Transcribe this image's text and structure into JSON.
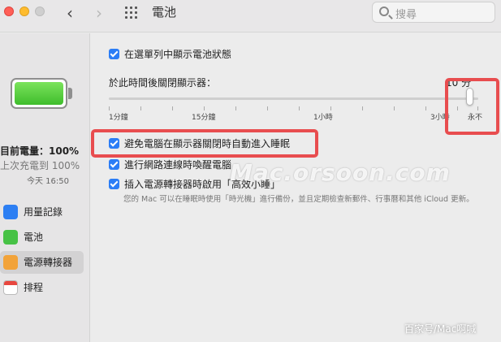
{
  "window": {
    "title": "電池"
  },
  "search": {
    "placeholder": "搜尋"
  },
  "sidebar": {
    "charge_label": "目前電量：100%",
    "last_charged": "上次充電到 100%",
    "time": "今天 16:50",
    "items": [
      {
        "label": "用量記錄",
        "icon": "bar-chart-icon"
      },
      {
        "label": "電池",
        "icon": "battery-icon"
      },
      {
        "label": "電源轉接器",
        "icon": "power-adapter-icon",
        "selected": true
      },
      {
        "label": "排程",
        "icon": "calendar-icon"
      }
    ]
  },
  "main": {
    "show_status_label": "在選單列中顯示電池狀態",
    "show_status_checked": true,
    "display_off_label": "於此時間後關閉顯示器：",
    "display_off_value": "10 分",
    "slider_ticks": [
      "1分鐘",
      "15分鐘",
      "1小時",
      "3小時",
      "永不"
    ],
    "slider_level": 1.0,
    "prevent_sleep_label": "避免電腦在顯示器關閉時自動進入睡眠",
    "prevent_sleep_checked": true,
    "wake_network_label": "進行網路連線時喚醒電腦",
    "wake_network_checked": true,
    "power_nap_label": "插入電源轉接器時啟用「高效小睡」",
    "power_nap_checked": true,
    "power_nap_note": "您的 Mac 可以在睡眠時使用「時光機」進行備份，並且定期檢查新郵件、行事曆和其他 iCloud 更新。"
  },
  "watermark": "Mac.orsoon.com",
  "credit": "百家号/Mac啊喊",
  "colors": {
    "highlight": "#e84d4f",
    "checkbox": "#2b7df6",
    "battery": "#4cc93a"
  }
}
